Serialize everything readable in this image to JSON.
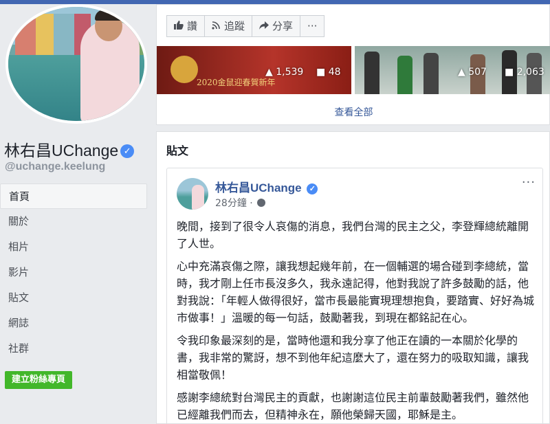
{
  "page": {
    "name": "林右昌UChange",
    "handle": "@uchange.keelung",
    "verified_mark": "✓"
  },
  "nav": {
    "items": [
      {
        "label": "首頁"
      },
      {
        "label": "關於"
      },
      {
        "label": "相片"
      },
      {
        "label": "影片"
      },
      {
        "label": "貼文"
      },
      {
        "label": "網誌"
      },
      {
        "label": "社群"
      }
    ],
    "create_fanpage": "建立粉絲專頁"
  },
  "actions": {
    "like": "讚",
    "follow": "追蹤",
    "share": "分享",
    "more": "···"
  },
  "photos": {
    "photo1": {
      "caption": "2020金鼠迎春賀新年",
      "likes": "1,539",
      "comments": "48"
    },
    "photo2": {
      "likes": "507",
      "comments": "2,063"
    },
    "see_all": "查看全部"
  },
  "posts_section": {
    "title": "貼文"
  },
  "post": {
    "author": "林右昌UChange",
    "time": "28分鐘 · ",
    "more": "···",
    "paragraphs": [
      "晚間，接到了很令人哀傷的消息，我們台灣的民主之父，李登輝總統離開了人世。",
      "心中充滿哀傷之際，讓我想起幾年前，在一個輔選的場合碰到李總統，當時，我才剛上任市長沒多久，我永遠記得，他對我說了許多鼓勵的話，他對我說：「年輕人做得很好，當市長最能實現理想抱負，要踏實、好好為城市做事！」溫暖的每一句話，鼓勵著我，到現在都銘記在心。",
      "令我印象最深刻的是，當時他還和我分享了他正在讀的一本關於化學的書，我非常的驚訝，想不到他年紀這麼大了，還在努力的吸取知識，讓我相當敬佩！",
      "感謝李總統對台灣民主的貢獻，也謝謝這位民主前輩鼓勵著我們，雖然他已經離我們而去，但精神永在，願他榮歸天國，耶穌是主。"
    ]
  },
  "icons": {
    "like": "thumbs-up-icon",
    "follow": "rss-icon",
    "share": "share-arrow-icon",
    "globe": "globe-icon"
  },
  "colors": {
    "brand": "#4267b2",
    "link": "#365899",
    "create_button": "#42b72a",
    "verified": "#4a8cf6"
  }
}
